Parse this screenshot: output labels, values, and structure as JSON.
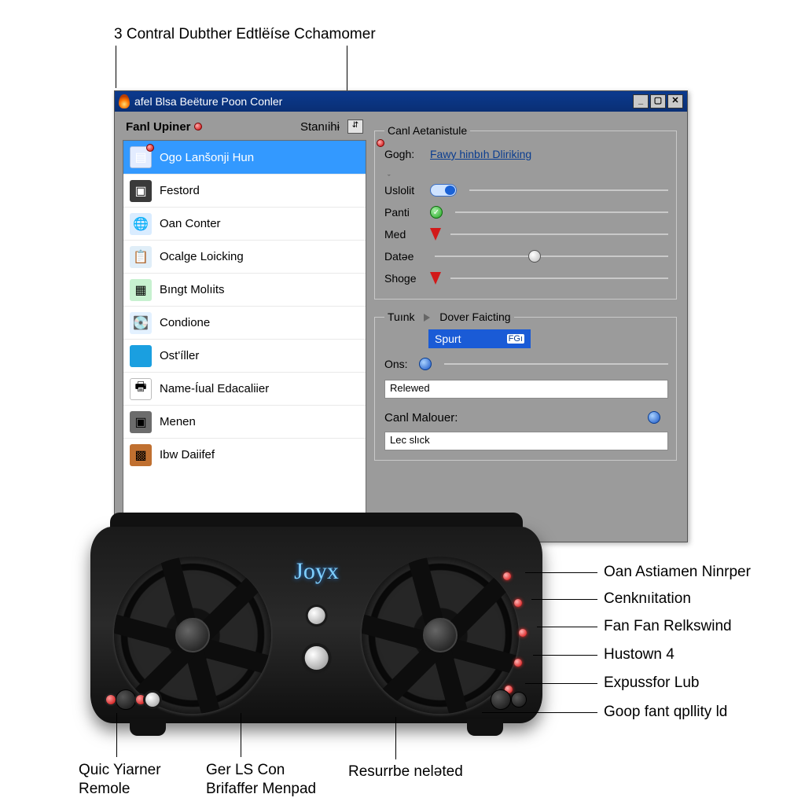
{
  "callouts": {
    "top_left": "3 Contral Dubther Edtlëíse Cchamomer",
    "right": {
      "a": "Oan Astiamen Ninrper",
      "b": "Cenknıitation",
      "c": "Fan Fan Relkswind",
      "d": "Hustown 4",
      "e": "Expussfor Lub",
      "f": "Goop fant qpllity ld"
    },
    "bottom": {
      "a1": "Quic Yiarner",
      "a2": "Remole",
      "b1": "Ger LS Con",
      "b2": "Brifaffer Menpad",
      "c": "Resurrbe neləted"
    }
  },
  "window": {
    "title": "afel Blsa Beëture Poon Conler",
    "left_header": {
      "title": "Fanl Upiner",
      "right": "Stanıihɨ"
    },
    "controls": {
      "updown": "⇵",
      "min": "_",
      "max": "▢",
      "close": "✕"
    },
    "list": [
      {
        "label": "Ogo Lanšonji Hun"
      },
      {
        "label": "Festord"
      },
      {
        "label": "Oan Conter"
      },
      {
        "label": "Ocalge Loicking"
      },
      {
        "label": "Bıngt Molıits"
      },
      {
        "label": "Condione"
      },
      {
        "label": "Ost'íller"
      },
      {
        "label": "Name-Íual Edacaliier"
      },
      {
        "label": "Menen"
      },
      {
        "label": "Ibw Daiifef"
      }
    ],
    "group1": {
      "legend": "Canl Aetanistule",
      "link_label": "Gogh:",
      "link_value": "Fawy hinbıh Dliriking",
      "rows": [
        {
          "label": "Uslolit",
          "kind": "toggle"
        },
        {
          "label": "Panti",
          "kind": "check"
        },
        {
          "label": "Med",
          "kind": "arrow"
        },
        {
          "label": "Datəe",
          "kind": "slider"
        },
        {
          "label": "Shoge",
          "kind": "arrow"
        }
      ]
    },
    "group2": {
      "legend_left": "Tuınk",
      "legend_right": "Dover Faicting",
      "spurt": "Spurt",
      "spurt_tag": "FGı",
      "ons_label": "Ons:",
      "relewed": "Relewed",
      "malouer_label": "Canl Malouer:",
      "lec": "Lec slıck"
    }
  },
  "device": {
    "logo": "Joyx"
  }
}
